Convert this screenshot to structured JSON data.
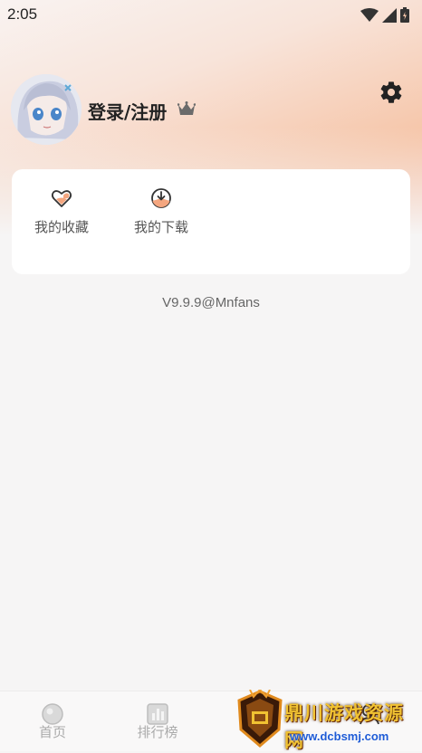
{
  "status_bar": {
    "time": "2:05"
  },
  "profile": {
    "login_label": "登录/注册"
  },
  "card": {
    "items": [
      {
        "label": "我的收藏",
        "icon": "heart-icon"
      },
      {
        "label": "我的下载",
        "icon": "download-icon"
      }
    ]
  },
  "version": "V9.9.9@Mnfans",
  "bottom_nav": {
    "items": [
      {
        "label": "首页",
        "icon": "home-icon"
      },
      {
        "label": "排行榜",
        "icon": "ranking-icon"
      },
      {
        "label": "",
        "icon": "profile-icon"
      }
    ]
  },
  "watermark": {
    "title": "鼎川游戏资源网",
    "url": "www.dcbsmj.com"
  },
  "colors": {
    "accent": "#f4a67f",
    "header_gradient_end": "#f4b497"
  }
}
